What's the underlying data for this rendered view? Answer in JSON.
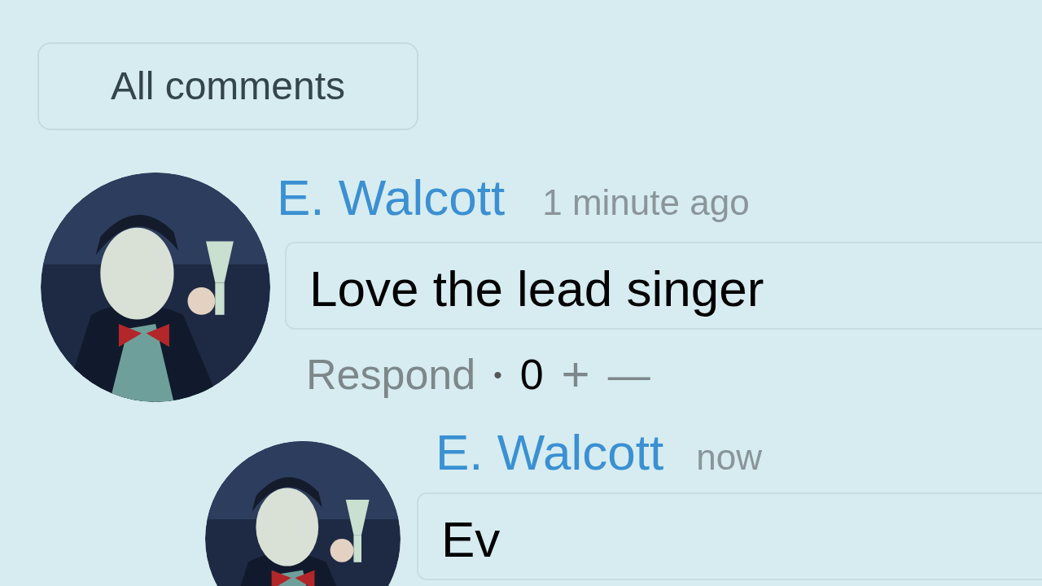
{
  "filter_button": "All comments",
  "comments": [
    {
      "author": "E. Walcott",
      "time": "1 minute ago",
      "text": "Love the lead singer",
      "actions": {
        "respond": "Respond",
        "separator": "•",
        "score": "0",
        "upvote": "+",
        "downvote": "—"
      },
      "children": [
        {
          "author": "E. Walcott",
          "time": "now",
          "text": "Ev"
        }
      ]
    }
  ]
}
